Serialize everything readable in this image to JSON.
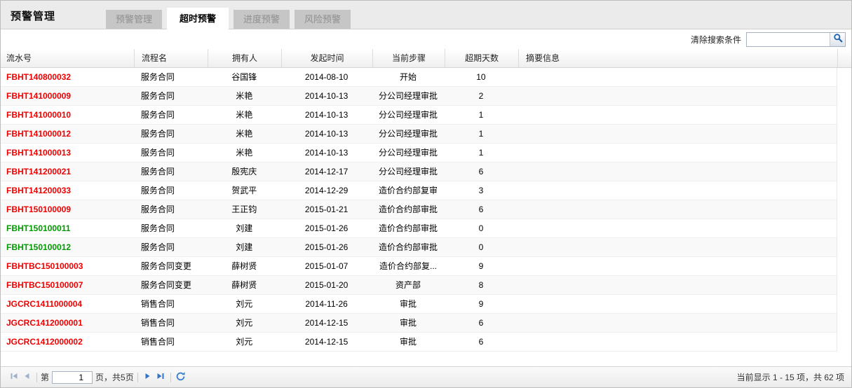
{
  "page": {
    "title": "预警管理"
  },
  "tabs": [
    {
      "key": "alert-management",
      "label": "预警管理",
      "active": false
    },
    {
      "key": "overtime-alert",
      "label": "超时预警",
      "active": true
    },
    {
      "key": "progress-alert",
      "label": "进度预警",
      "active": false
    },
    {
      "key": "risk-alert",
      "label": "风险预警",
      "active": false
    }
  ],
  "toolbar": {
    "clear_search_label": "清除搜索条件",
    "search_value": "",
    "search_placeholder": ""
  },
  "icons": {
    "search": "magnifier-icon",
    "first_page": "first-page-arrow",
    "prev_page": "prev-page-arrow",
    "next_page": "next-page-arrow",
    "last_page": "last-page-arrow",
    "refresh": "refresh-circular-arrow"
  },
  "colors": {
    "overdue": "#ee0000",
    "ontime": "#009900",
    "pager_enabled": "#3273c5",
    "pager_disabled": "#9fb1c9"
  },
  "table": {
    "columns": [
      {
        "label": "流水号"
      },
      {
        "label": "流程名"
      },
      {
        "label": "拥有人"
      },
      {
        "label": "发起时间"
      },
      {
        "label": "当前步骤"
      },
      {
        "label": "超期天数"
      },
      {
        "label": "摘要信息"
      }
    ],
    "rows": [
      {
        "id": "FBHT140800032",
        "color": "overdue",
        "process": "服务合同",
        "owner": "谷国锋",
        "start": "2014-08-10",
        "step": "开始",
        "days": "10",
        "summary": ""
      },
      {
        "id": "FBHT141000009",
        "color": "overdue",
        "process": "服务合同",
        "owner": "米艳",
        "start": "2014-10-13",
        "step": "分公司经理审批",
        "days": "2",
        "summary": ""
      },
      {
        "id": "FBHT141000010",
        "color": "overdue",
        "process": "服务合同",
        "owner": "米艳",
        "start": "2014-10-13",
        "step": "分公司经理审批",
        "days": "1",
        "summary": ""
      },
      {
        "id": "FBHT141000012",
        "color": "overdue",
        "process": "服务合同",
        "owner": "米艳",
        "start": "2014-10-13",
        "step": "分公司经理审批",
        "days": "1",
        "summary": ""
      },
      {
        "id": "FBHT141000013",
        "color": "overdue",
        "process": "服务合同",
        "owner": "米艳",
        "start": "2014-10-13",
        "step": "分公司经理审批",
        "days": "1",
        "summary": ""
      },
      {
        "id": "FBHT141200021",
        "color": "overdue",
        "process": "服务合同",
        "owner": "殷宪庆",
        "start": "2014-12-17",
        "step": "分公司经理审批",
        "days": "6",
        "summary": ""
      },
      {
        "id": "FBHT141200033",
        "color": "overdue",
        "process": "服务合同",
        "owner": "贺武平",
        "start": "2014-12-29",
        "step": "造价合约部复审",
        "days": "3",
        "summary": ""
      },
      {
        "id": "FBHT150100009",
        "color": "overdue",
        "process": "服务合同",
        "owner": "王正钧",
        "start": "2015-01-21",
        "step": "造价合约部审批",
        "days": "6",
        "summary": ""
      },
      {
        "id": "FBHT150100011",
        "color": "ontime",
        "process": "服务合同",
        "owner": "刘建",
        "start": "2015-01-26",
        "step": "造价合约部审批",
        "days": "0",
        "summary": ""
      },
      {
        "id": "FBHT150100012",
        "color": "ontime",
        "process": "服务合同",
        "owner": "刘建",
        "start": "2015-01-26",
        "step": "造价合约部审批",
        "days": "0",
        "summary": ""
      },
      {
        "id": "FBHTBC150100003",
        "color": "overdue",
        "process": "服务合同变更",
        "owner": "薛树贤",
        "start": "2015-01-07",
        "step": "造价合约部复...",
        "days": "9",
        "summary": ""
      },
      {
        "id": "FBHTBC150100007",
        "color": "overdue",
        "process": "服务合同变更",
        "owner": "薛树贤",
        "start": "2015-01-20",
        "step": "资产部",
        "days": "8",
        "summary": ""
      },
      {
        "id": "JGCRC1411000004",
        "color": "overdue",
        "process": "销售合同",
        "owner": "刘元",
        "start": "2014-11-26",
        "step": "审批",
        "days": "9",
        "summary": ""
      },
      {
        "id": "JGCRC1412000001",
        "color": "overdue",
        "process": "销售合同",
        "owner": "刘元",
        "start": "2014-12-15",
        "step": "审批",
        "days": "6",
        "summary": ""
      },
      {
        "id": "JGCRC1412000002",
        "color": "overdue",
        "process": "销售合同",
        "owner": "刘元",
        "start": "2014-12-15",
        "step": "审批",
        "days": "6",
        "summary": ""
      }
    ]
  },
  "pagination": {
    "page_prefix": "第",
    "page_value": "1",
    "page_suffix": "页，共5页",
    "status": "当前显示 1 - 15 项，共 62 项"
  }
}
